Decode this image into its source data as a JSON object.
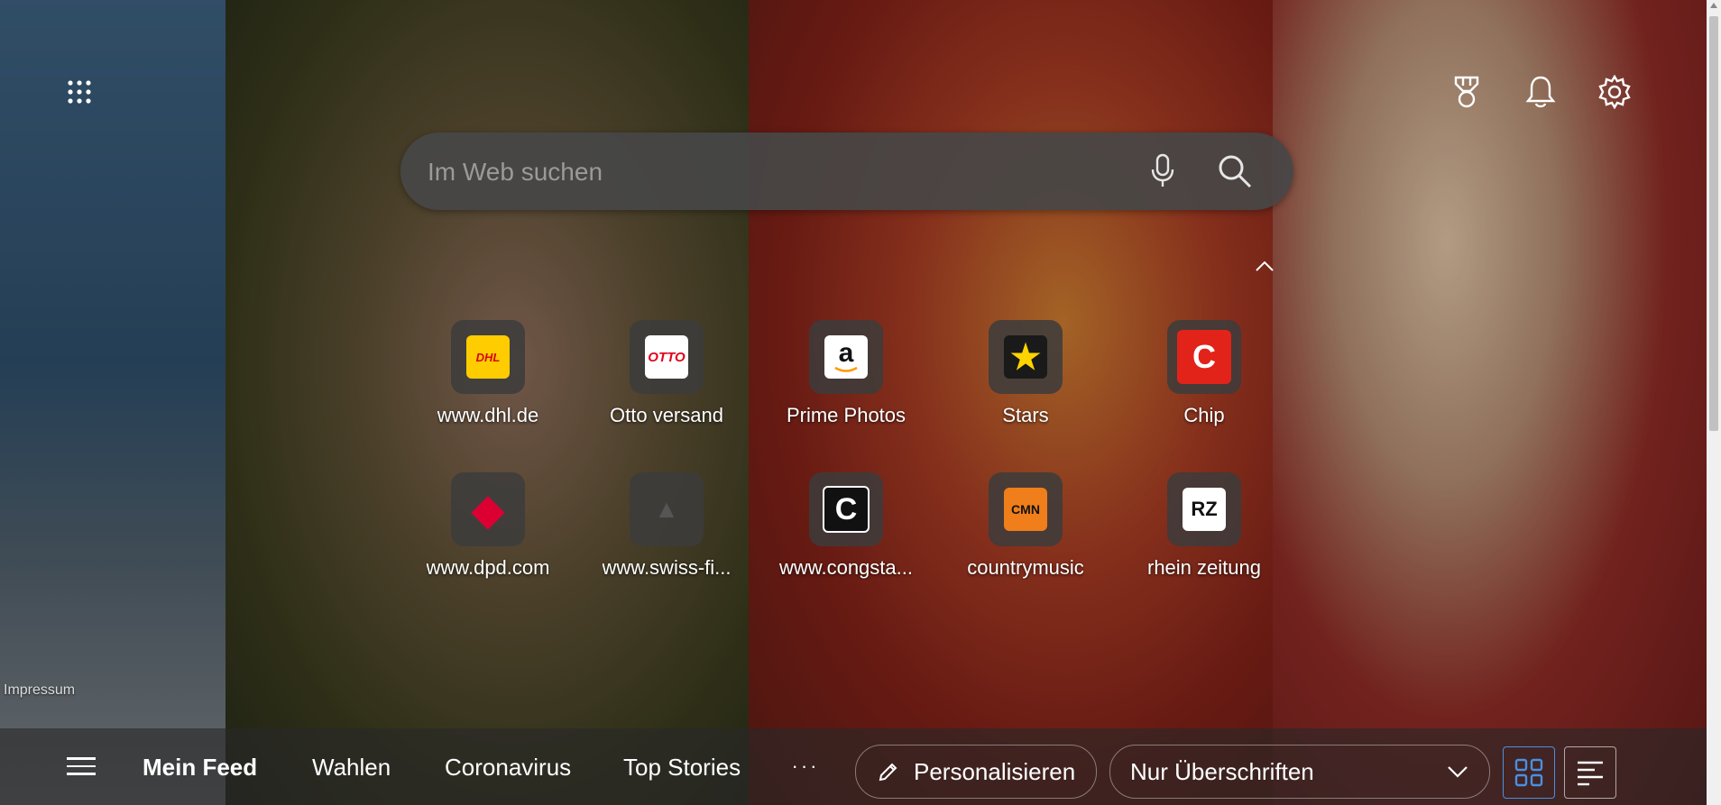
{
  "search": {
    "placeholder": "Im Web suchen"
  },
  "top_icons": [
    "apps-grid-icon",
    "rewards-trophy-icon",
    "notification-bell-icon",
    "settings-gear-icon"
  ],
  "quick_links": [
    {
      "label": "www.dhl.de",
      "logo_text": "DHL",
      "logo_bg": "#ffcc00",
      "logo_fg": "#d40511"
    },
    {
      "label": "Otto versand",
      "logo_text": "OTTO",
      "logo_bg": "#ffffff",
      "logo_fg": "#e2001a"
    },
    {
      "label": "Prime Photos",
      "logo_text": "a",
      "logo_bg": "#ffffff",
      "logo_fg": "#111111"
    },
    {
      "label": "Stars",
      "logo_text": "★",
      "logo_bg": "#1a1a1a",
      "logo_fg": "#ffd400"
    },
    {
      "label": "Chip",
      "logo_text": "C",
      "logo_bg": "#e2231a",
      "logo_fg": "#ffffff"
    },
    {
      "label": "www.dpd.com",
      "logo_text": "◆",
      "logo_bg": "transparent",
      "logo_fg": "#dc0032"
    },
    {
      "label": "www.swiss-fi...",
      "logo_text": "▲",
      "logo_bg": "transparent",
      "logo_fg": "#555555"
    },
    {
      "label": "www.congsta...",
      "logo_text": "C",
      "logo_bg": "#111111",
      "logo_fg": "#ffffff"
    },
    {
      "label": "countrymusic",
      "logo_text": "CMN",
      "logo_bg": "#f07e1a",
      "logo_fg": "#111111"
    },
    {
      "label": "rhein zeitung",
      "logo_text": "RZ",
      "logo_bg": "#ffffff",
      "logo_fg": "#111111"
    }
  ],
  "footer": {
    "impressum": "Impressum"
  },
  "feed_bar": {
    "tabs": [
      {
        "label": "Mein Feed",
        "active": true
      },
      {
        "label": "Wahlen",
        "active": false
      },
      {
        "label": "Coronavirus",
        "active": false
      },
      {
        "label": "Top Stories",
        "active": false
      }
    ],
    "more": "···",
    "personalize_label": "Personalisieren",
    "view_select": "Nur Überschriften",
    "active_view": "grid"
  },
  "colors": {
    "accent": "#4a8fe0"
  }
}
